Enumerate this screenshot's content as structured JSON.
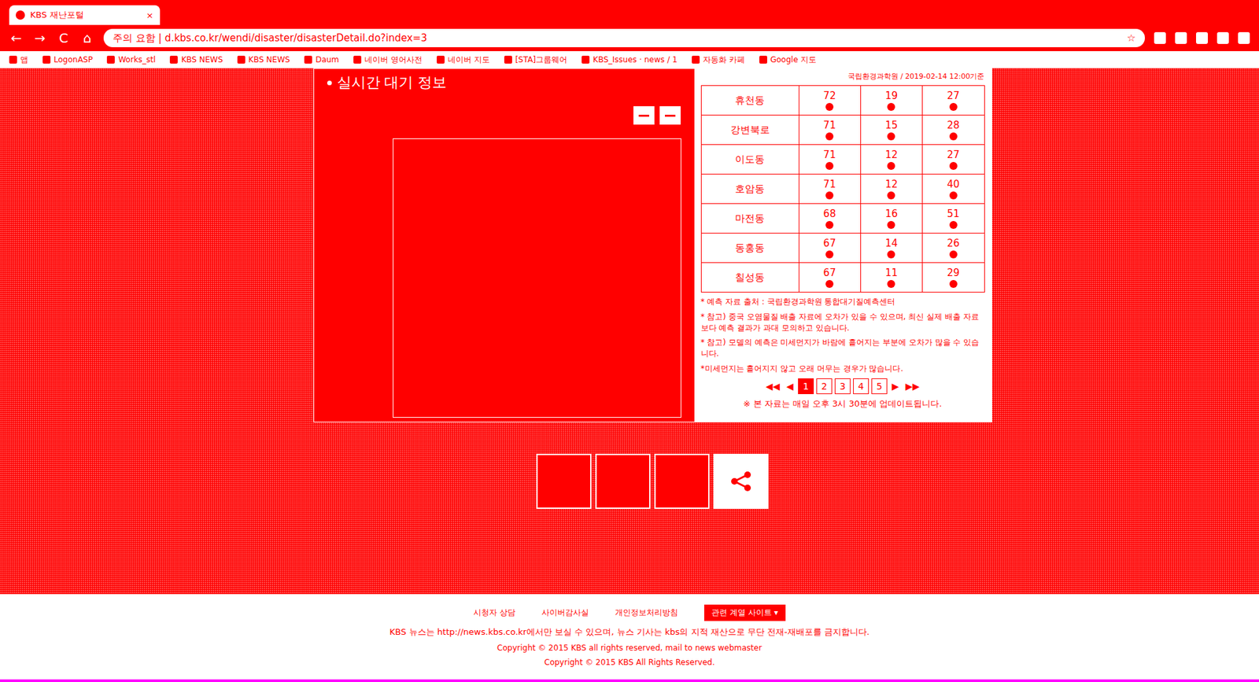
{
  "browser": {
    "tab": {
      "title": "KBS 재난포털",
      "close": "×"
    },
    "nav": [
      "←",
      "→",
      "C",
      "⌂"
    ],
    "address": "주의 요함 | d.kbs.co.kr/wendi/disaster/disasterDetail.do?index=3",
    "star": "☆",
    "bookmarks": [
      "앱",
      "LogonASP",
      "Works_stl",
      "KBS NEWS",
      "KBS NEWS",
      "Daum",
      "네이버 영어사전",
      "네이버 지도",
      "[STA]그룹웨어",
      "KBS_Issues · news / 1",
      "자동화 카페",
      "Google 지도"
    ]
  },
  "panel": {
    "title": "실시간 대기 정보",
    "source": "국립환경과학원 / 2019-02-14 12:00기준",
    "rows": [
      {
        "name": "휴천동",
        "values": [
          "72",
          "19",
          "27"
        ]
      },
      {
        "name": "강변북로",
        "values": [
          "71",
          "15",
          "28"
        ]
      },
      {
        "name": "이도동",
        "values": [
          "71",
          "12",
          "27"
        ]
      },
      {
        "name": "호암동",
        "values": [
          "71",
          "12",
          "40"
        ]
      },
      {
        "name": "마전동",
        "values": [
          "68",
          "16",
          "51"
        ]
      },
      {
        "name": "동홍동",
        "values": [
          "67",
          "14",
          "26"
        ]
      },
      {
        "name": "칠성동",
        "values": [
          "67",
          "11",
          "29"
        ]
      }
    ],
    "notes": [
      "* 예측 자료 출처 : 국립환경과학원 통합대기질예측센터",
      "* 참고) 중국 오염물질 배출 자료에 오차가 있을 수 있으며, 최신 실제 배출 자료보다 예측 결과가 과대 모의하고 있습니다.",
      "* 참고) 모델의 예측은 미세먼지가 바람에 흩어지는 부분에 오차가 많을 수 있습니다.",
      "*미세먼지는 흩어지지 않고 오래 머무는 경우가 많습니다."
    ],
    "pagination": {
      "first": "◀◀",
      "prev": "◀",
      "pages": [
        {
          "label": "1",
          "selected": true
        },
        {
          "label": "2",
          "selected": false
        },
        {
          "label": "3",
          "selected": false
        },
        {
          "label": "4",
          "selected": false
        },
        {
          "label": "5",
          "selected": false
        }
      ],
      "next": "▶",
      "last": "▶▶"
    },
    "update": "※ 본 자료는 매일 오후 3시 30분에 업데이트됩니다."
  },
  "footer": {
    "links": [
      "시청자 상담",
      "사이버감사실",
      "개인정보처리방침"
    ],
    "related": "관련 계열 사이트 ▾",
    "notice": "KBS 뉴스는 http://news.kbs.co.kr에서만 보실 수 있으며, 뉴스 기사는 kbs의 지적 재산으로 무단 전재-재배포를 금지합니다.",
    "copyright1": "Copyright © 2015 KBS all rights reserved, mail to news webmaster",
    "copyright2": "Copyright © 2015 KBS All Rights Reserved."
  }
}
